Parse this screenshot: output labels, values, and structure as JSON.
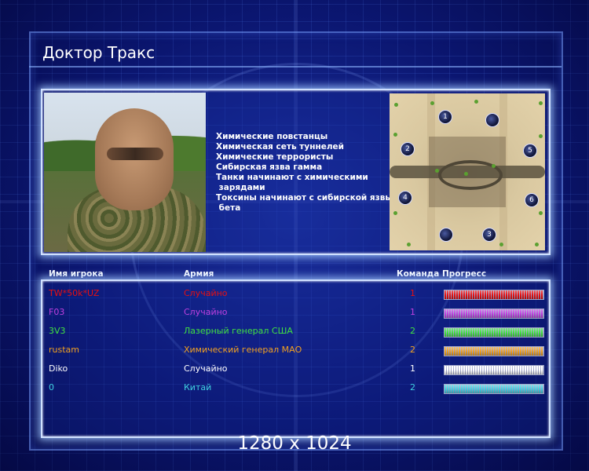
{
  "screen": {
    "title": "Доктор Тракс",
    "resolution_text": "1280 x 1024"
  },
  "general_info": {
    "tips": [
      "Химические повстанцы",
      "Химическая сеть туннелей",
      "Химические террористы",
      "Сибирская язва гамма",
      "Танки начинают с химическими",
      " зарядами",
      "Токсины начинают с сибирской язвы",
      " бета"
    ]
  },
  "map": {
    "start_positions": [
      "1",
      "",
      "2",
      "5",
      "4",
      "6",
      "",
      "3"
    ]
  },
  "player_table": {
    "headers": {
      "player_name": "Имя игрока",
      "army": "Армия",
      "team": "Команда",
      "progress": "Прогресс"
    },
    "rows": [
      {
        "name": "TW*50k*UZ",
        "army": "Случайно",
        "team": "1",
        "color": "#e81010",
        "progress": 1.0
      },
      {
        "name": "F03",
        "army": "Случайно",
        "team": "1",
        "color": "#c040e0",
        "progress": 1.0
      },
      {
        "name": "3V3",
        "army": "Лазерный генерал США",
        "team": "2",
        "color": "#40e040",
        "progress": 1.0
      },
      {
        "name": "rustam",
        "army": "Химический генерал МАО",
        "team": "2",
        "color": "#f0a020",
        "progress": 1.0
      },
      {
        "name": "Diko",
        "army": "Случайно",
        "team": "1",
        "color": "#ffffff",
        "progress": 1.0
      },
      {
        "name": "0",
        "army": "Китай",
        "team": "2",
        "color": "#40d0e0",
        "progress": 1.0
      }
    ]
  },
  "colors": {
    "background": "#0b1670",
    "panel_border": "#cfe0ff",
    "header_text": "#ffffff"
  }
}
